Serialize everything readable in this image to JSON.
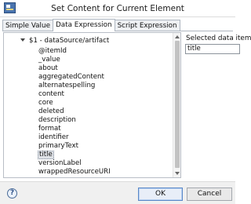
{
  "window": {
    "title": "Set Content for Current Element",
    "icon": "app-icon"
  },
  "tabs": [
    {
      "label": "Simple Value",
      "active": false
    },
    {
      "label": "Data Expression",
      "active": true
    },
    {
      "label": "Script Expression",
      "active": false
    }
  ],
  "tree": {
    "root_label": "$1 - dataSource/artifact",
    "items": [
      {
        "label": "@itemId"
      },
      {
        "label": "_value"
      },
      {
        "label": "about"
      },
      {
        "label": "aggregatedContent"
      },
      {
        "label": "alternatespelling"
      },
      {
        "label": "content"
      },
      {
        "label": "core"
      },
      {
        "label": "deleted"
      },
      {
        "label": "description"
      },
      {
        "label": "format"
      },
      {
        "label": "identifier"
      },
      {
        "label": "primaryText"
      },
      {
        "label": "title",
        "selected": true
      },
      {
        "label": "versionLabel"
      },
      {
        "label": "wrappedResourceURI"
      }
    ]
  },
  "selected_item": {
    "label": "Selected data item",
    "value": "title"
  },
  "footer": {
    "help_label": "?",
    "ok_label": "OK",
    "cancel_label": "Cancel"
  },
  "colors": {
    "accent": "#5a88c7",
    "selection": "#dfe2e7"
  }
}
